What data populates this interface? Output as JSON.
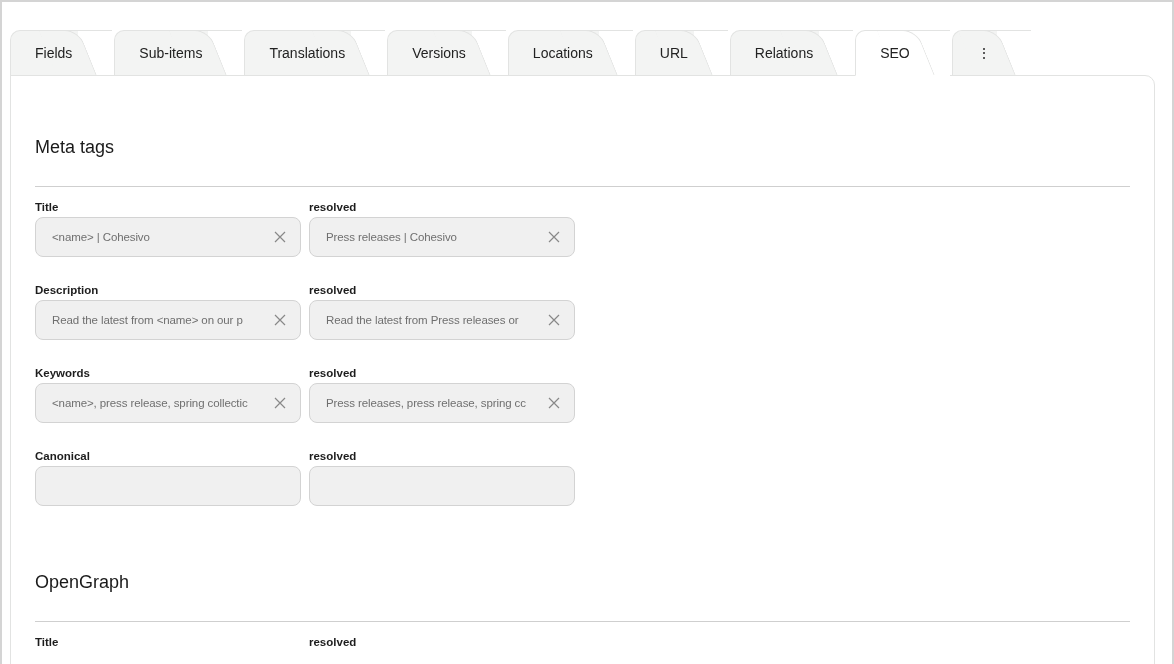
{
  "tabs": [
    {
      "label": "Fields",
      "selected": false
    },
    {
      "label": "Sub-items",
      "selected": false
    },
    {
      "label": "Translations",
      "selected": false
    },
    {
      "label": "Versions",
      "selected": false
    },
    {
      "label": "Locations",
      "selected": false
    },
    {
      "label": "URL",
      "selected": false
    },
    {
      "label": "Relations",
      "selected": false
    },
    {
      "label": "SEO",
      "selected": true
    },
    {
      "label": "⋮",
      "selected": false
    }
  ],
  "sections": [
    {
      "title": "Meta tags",
      "rows": [
        {
          "fields": [
            {
              "label": "Title",
              "input": {
                "value": "<name> | Cohesivo",
                "clearable": true
              }
            },
            {
              "label": "resolved",
              "input": {
                "value": "Press releases | Cohesivo",
                "clearable": true
              }
            }
          ]
        },
        {
          "fields": [
            {
              "label": "Description",
              "input": {
                "value": "Read the latest from <name> on our p",
                "clearable": true
              }
            },
            {
              "label": "resolved",
              "input": {
                "value": "Read the latest from Press releases or",
                "clearable": true
              }
            }
          ]
        },
        {
          "fields": [
            {
              "label": "Keywords",
              "input": {
                "value": "<name>, press release, spring collectic",
                "clearable": true
              }
            },
            {
              "label": "resolved",
              "input": {
                "value": "Press releases, press release, spring cc",
                "clearable": true
              }
            }
          ]
        },
        {
          "fields": [
            {
              "label": "Canonical",
              "input": {
                "clearable": false
              }
            },
            {
              "label": "resolved",
              "input": {
                "clearable": false
              }
            }
          ]
        }
      ]
    },
    {
      "title": "OpenGraph",
      "rows": [
        {
          "fields": [
            {
              "label": "Title"
            },
            {
              "label": "resolved"
            }
          ]
        }
      ]
    }
  ]
}
